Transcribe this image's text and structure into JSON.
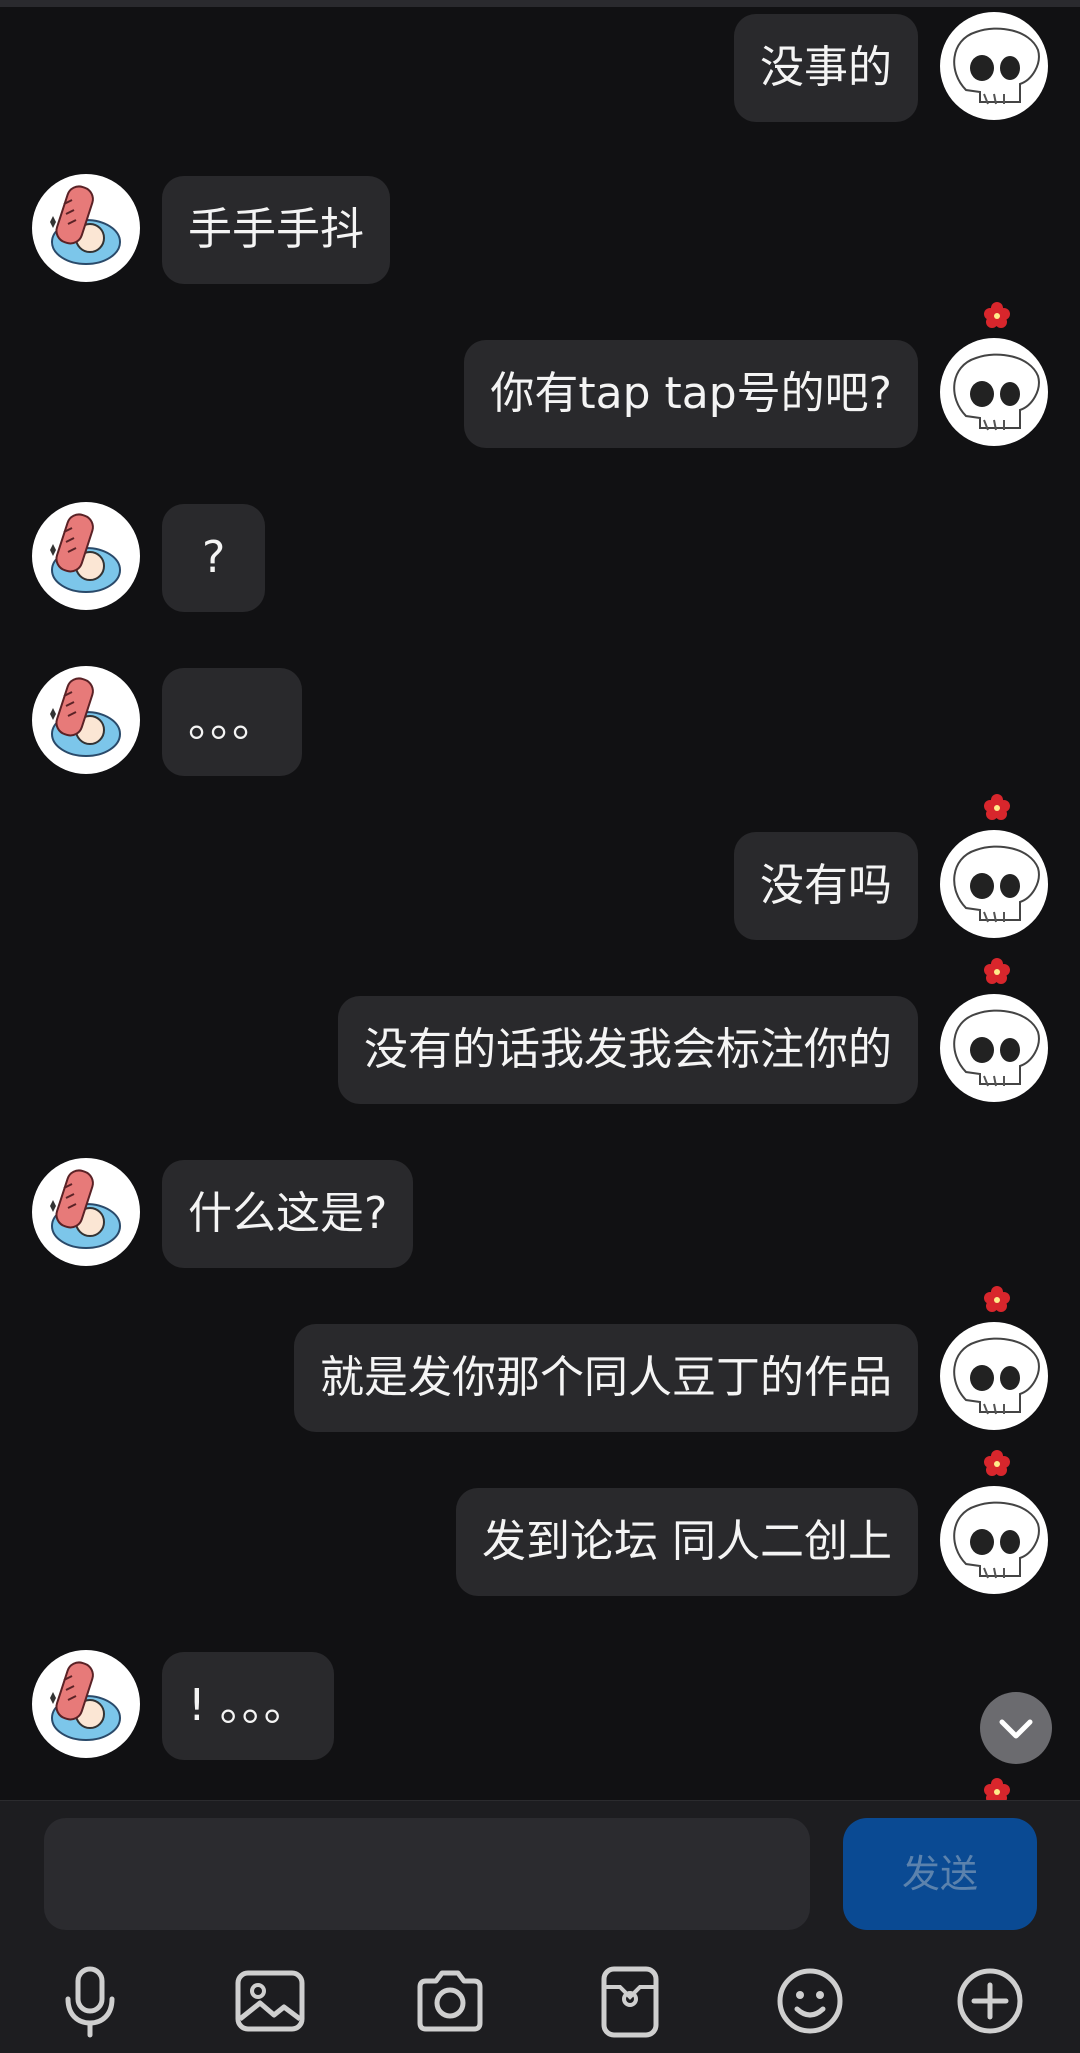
{
  "messages": [
    {
      "side": "right",
      "text": "没事的"
    },
    {
      "side": "left",
      "text": "手手手抖"
    },
    {
      "side": "right",
      "text": "你有tap tap号的吧?"
    },
    {
      "side": "left",
      "text": "?"
    },
    {
      "side": "left",
      "text": "。。。"
    },
    {
      "side": "right",
      "text": "没有吗"
    },
    {
      "side": "right",
      "text": "没有的话我发我会标注你的"
    },
    {
      "side": "left",
      "text": "什么这是?"
    },
    {
      "side": "right",
      "text": "就是发你那个同人豆丁的作品"
    },
    {
      "side": "right",
      "text": "发到论坛 同人二创上"
    },
    {
      "side": "left",
      "text": "! 。。。"
    }
  ],
  "composer": {
    "input_placeholder": "",
    "send_label": "发送"
  },
  "toolbar": {
    "icons": [
      "microphone-icon",
      "image-icon",
      "camera-icon",
      "sticker-icon",
      "emoji-icon",
      "plus-icon"
    ]
  },
  "colors": {
    "background": "#111113",
    "bubble": "#29292c",
    "send_button": "#0a4a93",
    "flower": "#d8262c"
  }
}
